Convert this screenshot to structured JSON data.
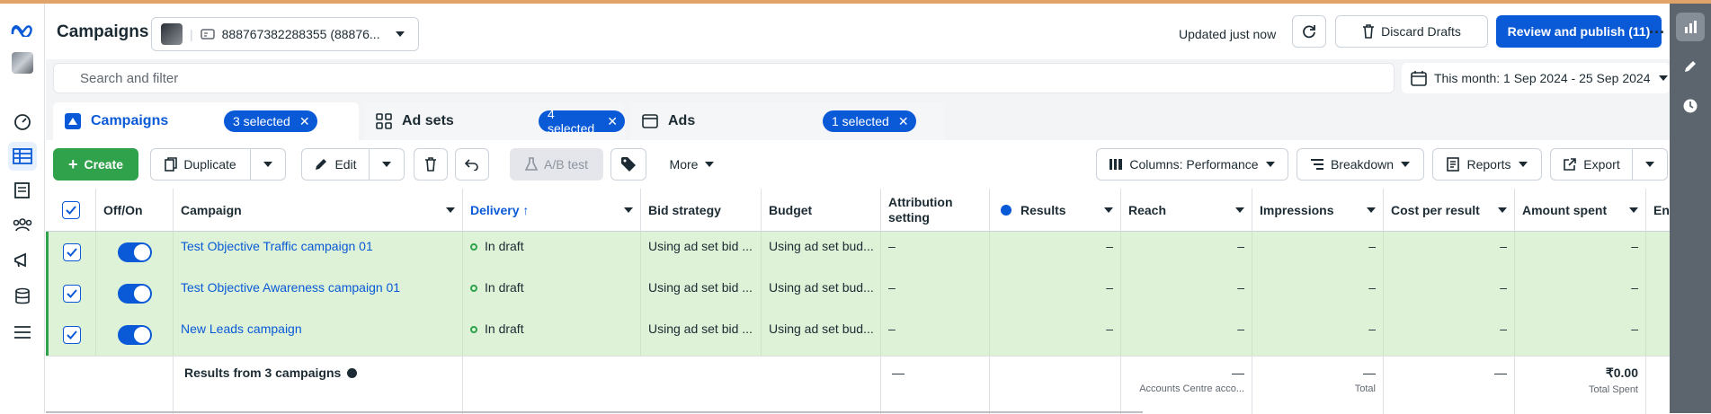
{
  "header": {
    "title": "Campaigns",
    "account": "888767382288355 (88876...",
    "updated": "Updated just now",
    "discard": "Discard Drafts",
    "review": "Review and publish (11)"
  },
  "search": {
    "placeholder": "Search and filter"
  },
  "date_range": "This month: 1 Sep 2024 - 25 Sep 2024",
  "tabs": [
    {
      "label": "Campaigns",
      "chip": "3 selected"
    },
    {
      "label": "Ad sets",
      "chip": "4 selected"
    },
    {
      "label": "Ads",
      "chip": "1 selected"
    }
  ],
  "toolbar": {
    "create": "Create",
    "duplicate": "Duplicate",
    "edit": "Edit",
    "ab_test": "A/B test",
    "more": "More",
    "columns": "Columns: Performance",
    "breakdown": "Breakdown",
    "reports": "Reports",
    "export": "Export"
  },
  "columns": {
    "off_on": "Off/On",
    "campaign": "Campaign",
    "delivery": "Delivery ↑",
    "bid": "Bid strategy",
    "budget": "Budget",
    "attribution": "Attribution setting",
    "results": "Results",
    "reach": "Reach",
    "impressions": "Impressions",
    "cpr": "Cost per result",
    "spent": "Amount spent",
    "ends": "En"
  },
  "rows": [
    {
      "name": "Test Objective Traffic campaign 01",
      "delivery": "In draft",
      "bid": "Using ad set bid ...",
      "budget": "Using ad set bud...",
      "dash": "–"
    },
    {
      "name": "Test Objective Awareness campaign 01",
      "delivery": "In draft",
      "bid": "Using ad set bid ...",
      "budget": "Using ad set bud...",
      "dash": "–"
    },
    {
      "name": "New Leads campaign",
      "delivery": "In draft",
      "bid": "Using ad set bid ...",
      "budget": "Using ad set bud...",
      "dash": "–"
    }
  ],
  "summary": {
    "label": "Results from 3 campaigns",
    "attribution": "—",
    "reach": "—",
    "reach_sub": "Accounts Centre acco...",
    "impressions": "—",
    "impressions_sub": "Total",
    "cpr": "—",
    "spent": "₹0.00",
    "spent_sub": "Total Spent"
  },
  "colors": {
    "accent": "#0a5ad8",
    "row_selected": "#ddf2d6",
    "create": "#31a24c"
  }
}
